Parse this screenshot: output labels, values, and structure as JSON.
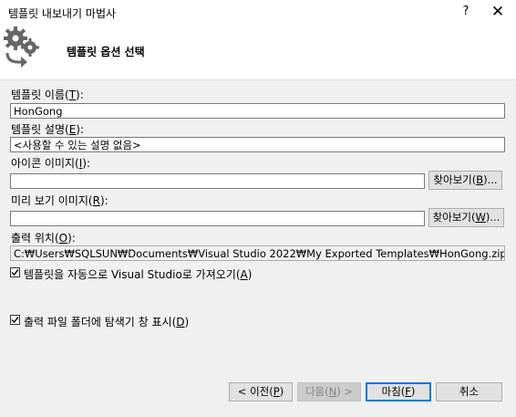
{
  "window": {
    "title": "템플릿 내보내기 마법사",
    "help": "?",
    "close": "✕"
  },
  "header": {
    "icon": "gear-export-icon",
    "title": "템플릿 옵션 선택"
  },
  "form": {
    "name_label": "템플릿 이름(",
    "name_key": "T",
    "name_value": "HonGong",
    "desc_label": "템플릿 설명(",
    "desc_key": "E",
    "desc_value": "<사용할 수 있는 설명 없음>",
    "icon_label": "아이콘 이미지(",
    "icon_key": "I",
    "icon_value": "",
    "icon_browse": "찾아보기(",
    "icon_browse_key": "B",
    "preview_label": "미리 보기 이미지(",
    "preview_key": "R",
    "preview_value": "",
    "preview_browse": "찾아보기(",
    "preview_browse_key": "W",
    "output_label": "출력 위치(",
    "output_key": "O",
    "output_value": "C:₩Users₩SQLSUN₩Documents₩Visual Studio 2022₩My Exported Templates₩HonGong.zip",
    "auto_import_label": "템플릿을 자동으로 Visual Studio로 가져오기(",
    "auto_import_key": "A",
    "auto_import_checked": true,
    "show_folder_label": "출력 파일 폴더에 탐색기 창 표시(",
    "show_folder_key": "D",
    "show_folder_checked": true
  },
  "buttons": {
    "prev": "< 이전(",
    "prev_key": "P",
    "next": "다음(",
    "next_key": "N",
    "next_suffix": ") >",
    "finish": "마침(",
    "finish_key": "F",
    "cancel": "취소"
  }
}
